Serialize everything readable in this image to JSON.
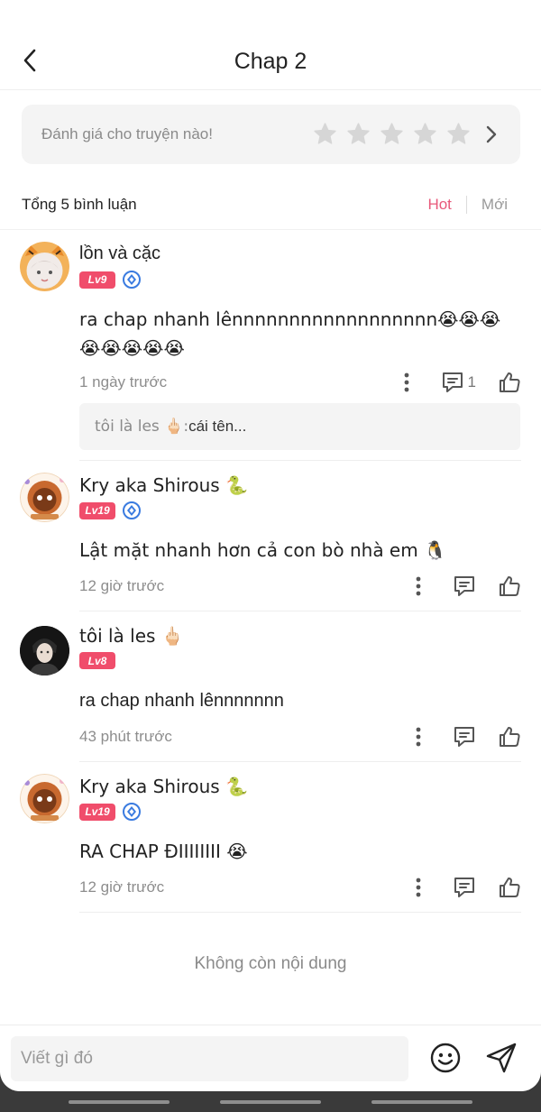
{
  "header": {
    "title": "Chap 2"
  },
  "rating": {
    "placeholder": "Đánh giá cho truyện nào!",
    "star_count": 5,
    "filled": 0
  },
  "comments_header": {
    "total": "Tổng 5 bình luận",
    "sort_hot": "Hot",
    "sort_new": "Mới"
  },
  "comments": [
    {
      "username": "lồn và cặc",
      "level": "Lv9",
      "verified": true,
      "text": "ra chap nhanh lênnnnnnnnnnnnnnnnnn😭😭😭😭😭😭😭😭",
      "time": "1 ngày trước",
      "reply_count": "1",
      "reply_preview": {
        "author": "tôi là les 🖕🏻: ",
        "text": "cái tên..."
      }
    },
    {
      "username": "Kry aka Shirous 🐍",
      "level": "Lv19",
      "verified": true,
      "text": "Lật mặt nhanh hơn cả con bò nhà em 🐧",
      "time": "12 giờ trước"
    },
    {
      "username": "tôi là les 🖕🏻",
      "level": "Lv8",
      "verified": false,
      "text": "ra chap nhanh lênnnnnnn",
      "time": "43 phút trước"
    },
    {
      "username": "Kry aka Shirous 🐍",
      "level": "Lv19",
      "verified": true,
      "text": "RA CHAP ĐIIIIIIII 😭",
      "time": "12 giờ trước"
    }
  ],
  "footer": {
    "no_more": "Không còn nội dung"
  },
  "input": {
    "placeholder": "Viết gì đó"
  },
  "colors": {
    "accent": "#e8587a",
    "level_badge": "#f04d6b",
    "verified": "#3a7be0"
  },
  "icons": [
    "back-arrow-icon",
    "star-icon",
    "chevron-right-icon",
    "more-vertical-icon",
    "comment-icon",
    "thumbs-up-icon",
    "smiley-icon",
    "send-icon"
  ]
}
